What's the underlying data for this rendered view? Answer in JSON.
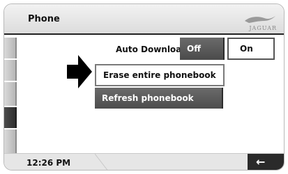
{
  "header": {
    "title": "Phone",
    "brand_logo_text": "JAGUAR"
  },
  "settings": {
    "auto_download": {
      "label": "Auto Download",
      "options": [
        "Off",
        "On"
      ],
      "selected": "Off"
    },
    "erase_phonebook_label": "Erase entire phonebook",
    "refresh_phonebook_label": "Refresh phonebook"
  },
  "footer": {
    "time": "12:26 PM"
  },
  "icons": {
    "pointer": "arrow-right-icon",
    "back": "back-arrow-icon",
    "brand": "jaguar-logo-icon"
  },
  "colors": {
    "selected_button": "#555555",
    "tab_dark": "#2e2e2e",
    "back_button": "#2a2a2a"
  }
}
